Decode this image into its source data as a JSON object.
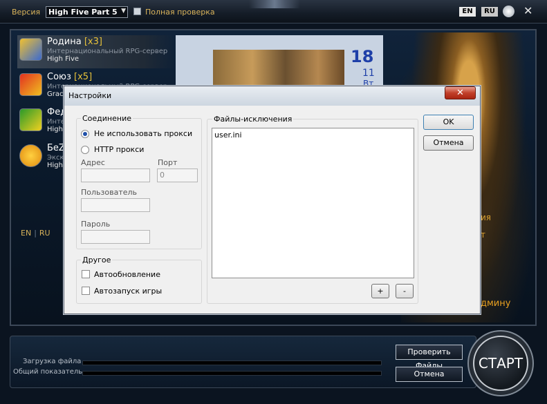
{
  "topbar": {
    "version_label": "Версия",
    "version_value": "High Five Part 5",
    "full_check_label": "Полная проверка",
    "lang_en": "EN",
    "lang_ru": "RU"
  },
  "servers": [
    {
      "name": "Родина",
      "rate": "[x3]",
      "desc": "Интернациональный RPG-сервер",
      "version": "High Five"
    },
    {
      "name": "Союз",
      "rate": "[x5]",
      "desc": "Интернациональный RPG-сервер",
      "version": "Grac"
    },
    {
      "name": "Фед",
      "rate": "",
      "desc": "Инте",
      "version": "High"
    },
    {
      "name": "БеZ",
      "rate": "",
      "desc": "Экск",
      "version": "High"
    }
  ],
  "news": {
    "day": "18",
    "month": "11",
    "weekday": "Вт"
  },
  "left_lang": {
    "en": "EN",
    "ru": "RU"
  },
  "right_side": {
    "line1": "ия",
    "line2": "т",
    "line3": "дмину"
  },
  "launcher": {
    "load_label": "Загрузка файла",
    "total_label": "Общий показатель",
    "check_files_label": "Проверить Файлы",
    "cancel_label": "Отмена",
    "start_label": "СТАРТ"
  },
  "dialog": {
    "title": "Настройки",
    "close_glyph": "✕",
    "connection_title": "Соединение",
    "no_proxy_label": "Не использовать прокси",
    "http_proxy_label": "HTTP прокси",
    "address_label": "Адрес",
    "port_label": "Порт",
    "port_value": "0",
    "user_label": "Пользователь",
    "password_label": "Пароль",
    "other_title": "Другое",
    "autoupdate_label": "Автообновление",
    "autostart_label": "Автозапуск игры",
    "files_title": "Файлы-исключения",
    "files": [
      "user.ini"
    ],
    "add_label": "+",
    "remove_label": "-",
    "ok_label": "OK",
    "cancel_label": "Отмена"
  }
}
